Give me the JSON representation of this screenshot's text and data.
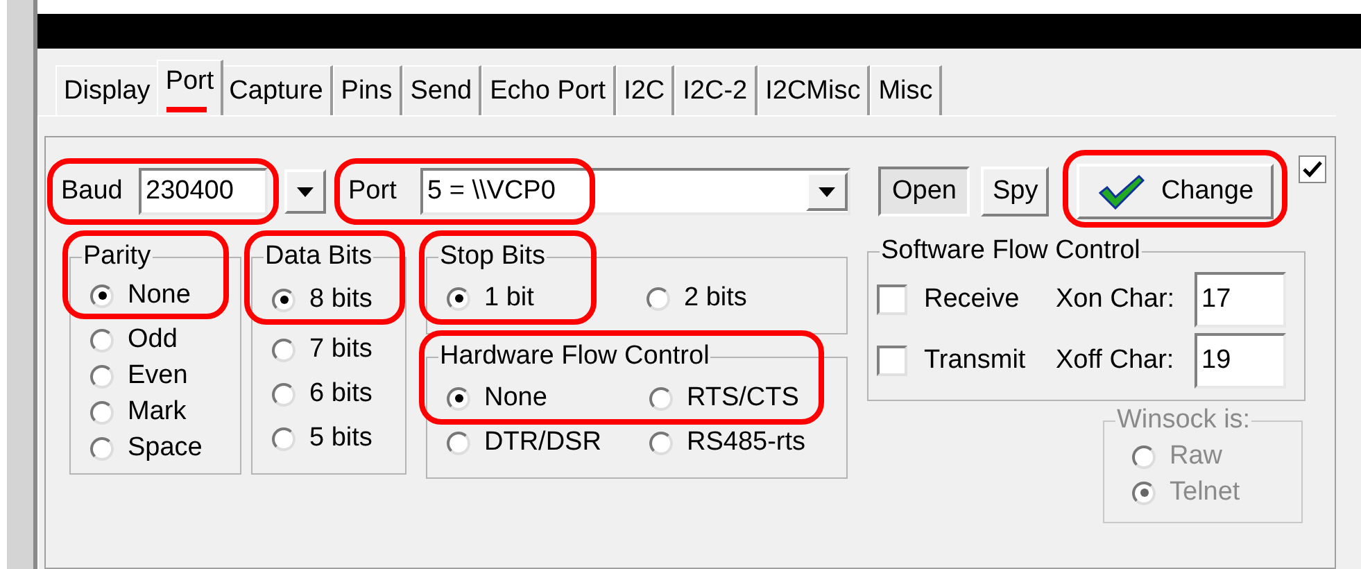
{
  "tabs": [
    {
      "label": "Display",
      "selected": false
    },
    {
      "label": "Port",
      "selected": true
    },
    {
      "label": "Capture",
      "selected": false
    },
    {
      "label": "Pins",
      "selected": false
    },
    {
      "label": "Send",
      "selected": false
    },
    {
      "label": "Echo Port",
      "selected": false
    },
    {
      "label": "I2C",
      "selected": false
    },
    {
      "label": "I2C-2",
      "selected": false
    },
    {
      "label": "I2CMisc",
      "selected": false
    },
    {
      "label": "Misc",
      "selected": false
    }
  ],
  "baud": {
    "label": "Baud",
    "value": "230400"
  },
  "port": {
    "label": "Port",
    "value": "5 = \\\\VCP0"
  },
  "buttons": [
    {
      "label": "Open",
      "kind": "toggle",
      "pressed": true
    },
    {
      "label": "Spy",
      "kind": "toggle",
      "pressed": false
    },
    {
      "label": "Change",
      "kind": "change",
      "pressed": false
    }
  ],
  "change_checkbox": {
    "checked": true
  },
  "parity": {
    "title": "Parity",
    "options": [
      {
        "label": "None",
        "selected": true
      },
      {
        "label": "Odd",
        "selected": false
      },
      {
        "label": "Even",
        "selected": false
      },
      {
        "label": "Mark",
        "selected": false
      },
      {
        "label": "Space",
        "selected": false
      }
    ]
  },
  "data_bits": {
    "title": "Data Bits",
    "options": [
      {
        "label": "8 bits",
        "selected": true
      },
      {
        "label": "7 bits",
        "selected": false
      },
      {
        "label": "6 bits",
        "selected": false
      },
      {
        "label": "5 bits",
        "selected": false
      }
    ]
  },
  "stop_bits": {
    "title": "Stop Bits",
    "options": [
      {
        "label": "1 bit",
        "selected": true
      },
      {
        "label": "2 bits",
        "selected": false
      }
    ]
  },
  "hardware_flow_control": {
    "title": "Hardware Flow Control",
    "options": [
      {
        "label": "None",
        "selected": true
      },
      {
        "label": "RTS/CTS",
        "selected": false
      },
      {
        "label": "DTR/DSR",
        "selected": false
      },
      {
        "label": "RS485-rts",
        "selected": false
      }
    ]
  },
  "software_flow_control": {
    "title": "Software Flow Control",
    "rows": [
      {
        "label": "Receive",
        "checked": false,
        "char_label": "Xon Char:",
        "char_value": "17"
      },
      {
        "label": "Transmit",
        "checked": false,
        "char_label": "Xoff Char:",
        "char_value": "19"
      }
    ]
  },
  "winsock": {
    "title": "Winsock is:",
    "disabled": true,
    "options": [
      {
        "label": "Raw",
        "selected": false
      },
      {
        "label": "Telnet",
        "selected": true
      }
    ]
  }
}
